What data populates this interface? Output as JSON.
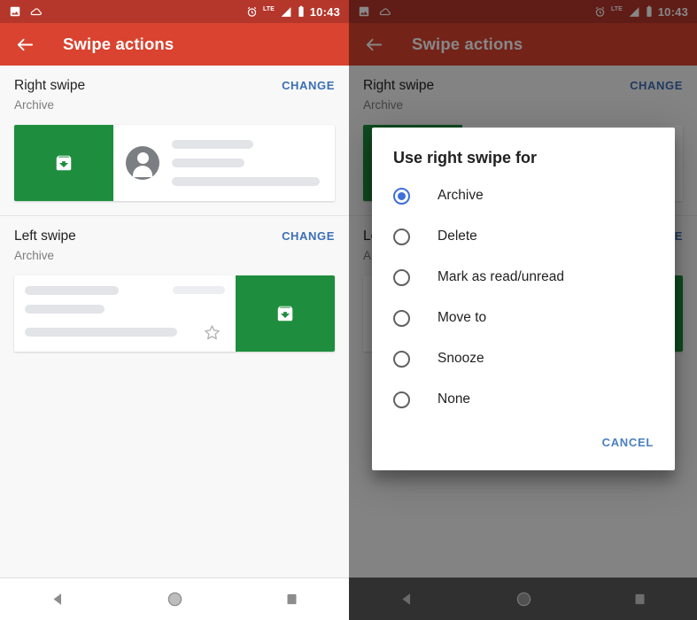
{
  "status_bar": {
    "icons_left": [
      "photo-icon",
      "shoe-fitness-icon"
    ],
    "icons_right": [
      "alarm-icon",
      "lte-signal-icon",
      "battery-icon"
    ],
    "lte_label": "LTE",
    "time": "10:43",
    "bg_color": "#b5362a"
  },
  "app_bar": {
    "back_icon": "arrow-back-icon",
    "title": "Swipe actions",
    "bg_color": "#d9432f"
  },
  "sections": [
    {
      "title": "Right swipe",
      "subtitle": "Archive",
      "action_label": "CHANGE",
      "swipe_side": "left",
      "swipe_icon": "archive-icon",
      "swipe_color": "#1e8e3e"
    },
    {
      "title": "Left swipe",
      "subtitle": "Archive",
      "action_label": "CHANGE",
      "swipe_side": "right",
      "swipe_icon": "archive-icon",
      "swipe_color": "#1e8e3e"
    }
  ],
  "nav_bar": {
    "back": "nav-back-triangle-icon",
    "home": "nav-home-circle-icon",
    "recents": "nav-recents-square-icon"
  },
  "dialog": {
    "title": "Use right swipe for",
    "options": [
      {
        "label": "Archive",
        "selected": true
      },
      {
        "label": "Delete",
        "selected": false
      },
      {
        "label": "Mark as read/unread",
        "selected": false
      },
      {
        "label": "Move to",
        "selected": false
      },
      {
        "label": "Snooze",
        "selected": false
      },
      {
        "label": "None",
        "selected": false
      }
    ],
    "cancel_label": "CANCEL",
    "accent_color": "#3f6fd8",
    "cancel_color": "#4c7fbe"
  },
  "colors": {
    "accent_green": "#1e8e3e",
    "link_blue": "#3b6fb5",
    "background": "#f8f8f8"
  }
}
